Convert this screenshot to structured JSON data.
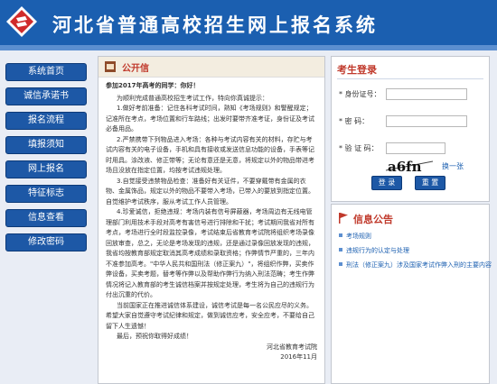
{
  "header": {
    "title": "河北省普通高校招生网上报名系统"
  },
  "nav": {
    "items": [
      "系统首页",
      "诚信承诺书",
      "报名流程",
      "填报须知",
      "网上报名",
      "特征标志",
      "信息查看",
      "修改密码"
    ]
  },
  "letter": {
    "title": "公开信",
    "greeting": "参加2017年高考的同学：你好！",
    "intro": "为顺利完成普通高校招生考试工作，特向你真诚提示：",
    "p1": "1.做好考前准备：记住各科考试时间，熟知《考场规则》和警醒规定；记准所在考点，考场位置和行车路线；出发时要带齐准考证，身份证及考试必备用品。",
    "p2": "2.严禁携带下列物品进入考场：各种与考试内容有关的材料，存贮与考试内容有关的电子设备，手机和具有接收或发送信息功能的设备，手表等记时用具。涂改液、修正带等；无论有意还是无意，将规定以外的物品带进考场且没放在指定位置，均按考试违规处理。",
    "p3": "3.自觉接受违禁物品检查：准备好有关证件，不要穿戴带有金属的衣物、金属饰品，规定以外的物品不要带入考场，已带入的要放到指定位置。自觉维护考试秩序，服从考试工作人员管理。",
    "p4": "4.珍爱诚信，拒绝违规：考场内装有信号屏蔽器，考场周边有无线电管理部门利用技术手段对高考有害信号进行排除和干扰；考试期间我省对所有考点，考场进行全时段监控录像，考试结束后省教育考试院将组织考场录像回放审查，总之，无论是考场发现的违规，还是通过录像回放发现的违规，我省均按教育部规定取消其高考成绩和录取资格；作弊情节严重的，三年内不准参加高考。\"中华人民共和国刑法（修正案九）\"，将组织作弊，买卖作弊设备，买卖考题，替考等作弊以及帮助作弊行为纳入刑法范畴；考生作弊情况将记入教育部的考生诚信档案并按规定处理，考生将为自己的违规行为付出沉重的代价。",
    "p5": "当前国家正在推进诚信体系建设，诚信考试是每一名公民应尽的义务。希望大家自觉遵守考试纪律和规定，做到诚信应考，安全应考，不要给自己留下人生遗憾！",
    "p6": "最后，预祝你取得好成绩！",
    "signature": "河北省教育考试院",
    "date": "2016年11月"
  },
  "login": {
    "title": "考生登录",
    "id_label": "* 身份证号：",
    "pwd_label": "* 密    码：",
    "captcha_label": "* 验 证 码：",
    "captcha_text": "a6fn",
    "change_link": "换一张",
    "login_btn": "登 录",
    "reset_btn": "重 置"
  },
  "notice": {
    "title": "信息公告",
    "items": [
      "考场规则",
      "违规行为的认定与处理",
      "刑法（修正案九）涉及国家考试作弊入刑的主要内容"
    ]
  },
  "colors": {
    "brand": "#1b5fb0",
    "accent": "#c0392b"
  }
}
